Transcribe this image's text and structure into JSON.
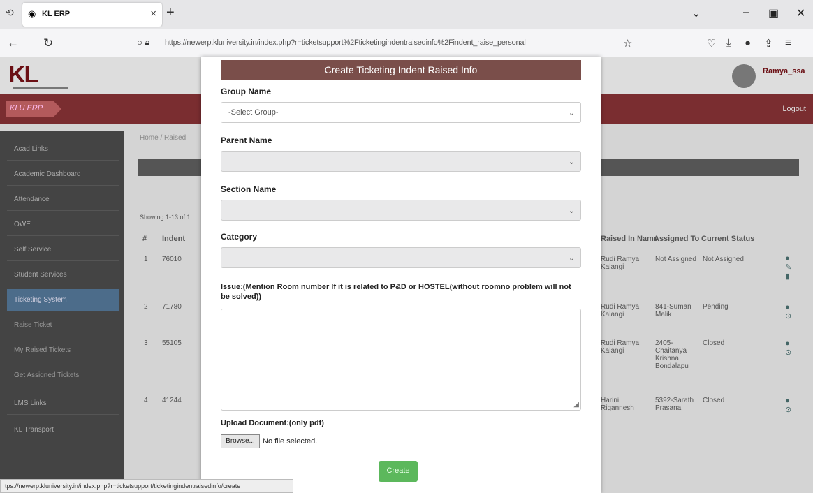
{
  "browser": {
    "tab_title": "KL ERP",
    "url": "https://newerp.kluniversity.in/index.php?r=ticketsupport%2Fticketingindentraisedinfo%2Findent_raise_personal",
    "status_url": "tps://newerp.kluniversity.in/index.php?r=ticketsupport/ticketingindentraisedinfo/create"
  },
  "app": {
    "logo": "KL",
    "brand": "KLU ERP",
    "user": "Ramya_ssa",
    "logout": "Logout",
    "crumbs": "Home / Raised",
    "showing": "Showing 1-13 of 1",
    "sidebar_items": [
      "Acad Links",
      "Academic Dashboard",
      "Attendance",
      "OWE",
      "Self Service",
      "Student Services",
      "Ticketing System"
    ],
    "sidebar_subs": [
      "Raise Ticket",
      "My Raised Tickets",
      "Get Assigned Tickets"
    ],
    "sidebar_after": [
      "LMS Links",
      "KL Transport"
    ],
    "table": {
      "headers": [
        "#",
        "Indent",
        "Raised In Name",
        "Assigned To",
        "Current Status"
      ],
      "rows": [
        {
          "num": "1",
          "indent": "76010",
          "raised": "Rudi Ramya Kalangi",
          "assigned": "Not Assigned",
          "status": "Not Assigned"
        },
        {
          "num": "2",
          "indent": "71780",
          "raised": "Rudi Ramya Kalangi",
          "assigned": "841-Suman Malik",
          "status": "Pending"
        },
        {
          "num": "3",
          "indent": "55105",
          "raised": "Rudi Ramya Kalangi",
          "assigned": "2405-Chaitanya Krishna Bondalapu",
          "status": "Closed"
        },
        {
          "num": "4",
          "indent": "41244",
          "raised": "Harini Rigannesh",
          "assigned": "5392-Sarath Prasana",
          "status": "Closed"
        }
      ]
    }
  },
  "modal": {
    "title": "Create Ticketing Indent Raised Info",
    "group_label": "Group Name",
    "group_placeholder": "-Select Group-",
    "parent_label": "Parent Name",
    "section_label": "Section Name",
    "category_label": "Category",
    "issue_label": "Issue:(Mention Room number If it is related to P&D or HOSTEL(without roomno problem will not be solved))",
    "upload_label": "Upload Document:(only pdf)",
    "browse_label": "Browse...",
    "no_file": "No file selected.",
    "create_label": "Create"
  },
  "colors": {
    "modal_header": "#7a4e4a",
    "create_button": "#5cb85c",
    "app_redbar": "#7a2d30"
  }
}
